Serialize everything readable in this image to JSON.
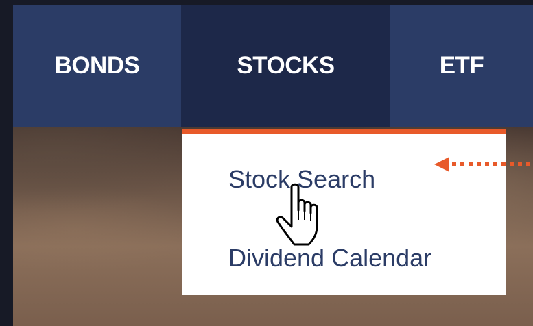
{
  "nav": {
    "items": [
      {
        "label": "BONDS"
      },
      {
        "label": "STOCKS"
      },
      {
        "label": "ETF"
      }
    ],
    "active_index": 1
  },
  "dropdown": {
    "items": [
      {
        "label": "Stock Search"
      },
      {
        "label": "Dividend Calendar"
      }
    ]
  },
  "icons": {
    "cursor": "hand-pointer-icon",
    "callout": "dotted-arrow-left-icon"
  },
  "colors": {
    "nav_bg": "#2b3c66",
    "nav_active_bg": "#1d2849",
    "accent": "#e85a2a",
    "dropdown_text": "#2b3c66",
    "page_bg": "#171a26"
  }
}
